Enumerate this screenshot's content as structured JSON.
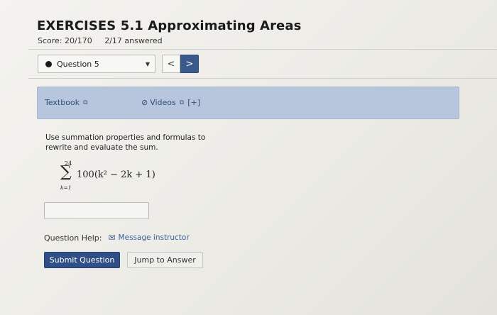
{
  "header": {
    "title": "EXERCISES 5.1 Approximating Areas",
    "score": "Score: 20/170",
    "answered": "2/17 answered"
  },
  "navigation": {
    "question_selected": "Question 5",
    "prev_label": "<",
    "next_label": ">"
  },
  "resources": {
    "textbook_label": "Textbook",
    "videos_label": "Videos",
    "videos_expand": "[+]"
  },
  "question": {
    "prompt": "Use summation properties and formulas to rewrite and evaluate the sum.",
    "sum_upper": "24",
    "sum_lower": "k=1",
    "sum_symbol": "∑",
    "expression": "100(k² − 2k + 1)",
    "answer_value": ""
  },
  "help": {
    "label": "Question Help:",
    "message_instructor": "Message instructor"
  },
  "actions": {
    "submit_label": "Submit Question",
    "jump_label": "Jump to Answer"
  },
  "colors": {
    "accent": "#2f4f86",
    "resource_bar": "#b7c6dc",
    "link": "#3c5f96"
  },
  "icons": {
    "external_link": "external-link-icon",
    "paperclip": "paperclip-icon",
    "mail": "mail-icon",
    "caret": "chevron-down-icon",
    "status_dot": "status-dot-icon"
  }
}
